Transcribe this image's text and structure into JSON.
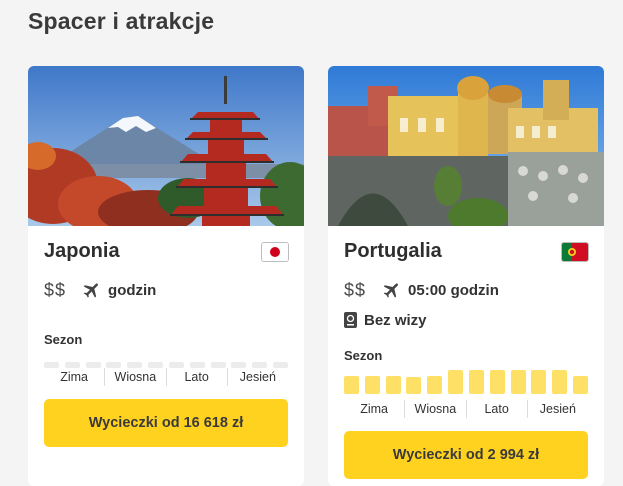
{
  "page": {
    "title": "Spacer i atrakcje"
  },
  "colors": {
    "accent": "#ffd21f",
    "bar_inactive": "#ececec",
    "bar_active": "#ffe066"
  },
  "cards": [
    {
      "country": "Japonia",
      "image": "mount-fuji-pagoda-photo",
      "flag_icon": "japan-flag-icon",
      "price": "$$",
      "duration": "godzin",
      "visa": null,
      "season_label": "Sezon",
      "season_levels": [
        0,
        0,
        0,
        0,
        0,
        0,
        0,
        0,
        0,
        0,
        0,
        0
      ],
      "months": [
        "Zima",
        "Wiosna",
        "Lato",
        "Jesień"
      ],
      "cta": "Wycieczki od 16 618 zł"
    },
    {
      "country": "Portugalia",
      "image": "pena-palace-photo",
      "flag_icon": "portugal-flag-icon",
      "price": "$$",
      "duration": "05:00 godzin",
      "visa": "Bez wizy",
      "season_label": "Sezon",
      "season_levels": [
        0.65,
        0.65,
        0.65,
        0.6,
        0.65,
        1,
        1,
        1,
        1,
        1,
        1,
        0.65
      ],
      "months": [
        "Zima",
        "Wiosna",
        "Lato",
        "Jesień"
      ],
      "cta": "Wycieczki od 2 994 zł"
    }
  ]
}
